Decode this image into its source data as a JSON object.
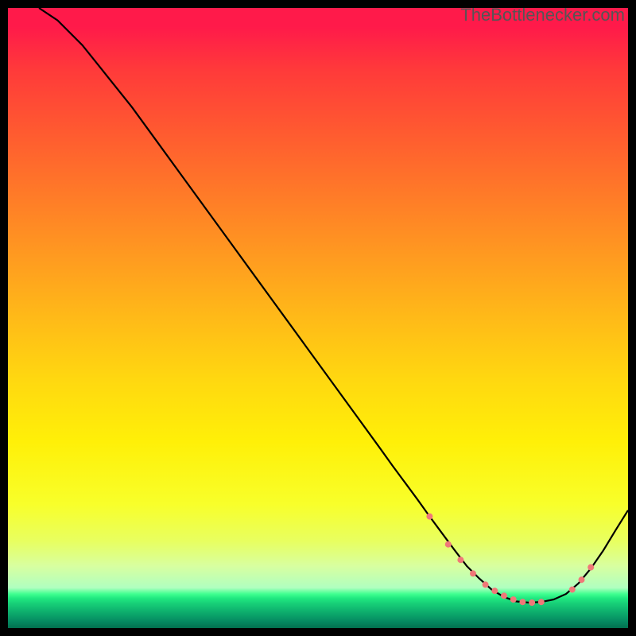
{
  "watermark": "TheBottlenecker.com",
  "chart_data": {
    "type": "line",
    "title": "",
    "xlabel": "",
    "ylabel": "",
    "xlim": [
      0,
      100
    ],
    "ylim": [
      0,
      100
    ],
    "grid": false,
    "legend": false,
    "background_gradient": {
      "direction": "vertical",
      "stops": [
        {
          "pos": 0,
          "color": "#ff1a4a",
          "meaning": "worst"
        },
        {
          "pos": 50,
          "color": "#ffd000",
          "meaning": "mid"
        },
        {
          "pos": 95,
          "color": "#20e880",
          "meaning": "best"
        }
      ]
    },
    "series": [
      {
        "name": "bottleneck-curve",
        "color": "#000000",
        "x": [
          5,
          8,
          12,
          16,
          20,
          24,
          28,
          32,
          36,
          40,
          44,
          48,
          52,
          56,
          60,
          62,
          64,
          66,
          68,
          70,
          72,
          74,
          76,
          78,
          80,
          82,
          84,
          86,
          88,
          90,
          92,
          94,
          96,
          98,
          100
        ],
        "y": [
          100,
          98,
          94,
          89,
          84,
          78.5,
          73,
          67.5,
          62,
          56.5,
          51,
          45.5,
          40,
          34.5,
          29,
          26.2,
          23.5,
          20.8,
          18,
          15.3,
          12.6,
          10,
          8,
          6.2,
          5,
          4.3,
          4.1,
          4.2,
          4.6,
          5.5,
          7.2,
          9.6,
          12.5,
          15.8,
          19
        ]
      }
    ],
    "markers": [
      {
        "name": "optimal-points",
        "color": "#f07878",
        "shape": "circle",
        "size": 8,
        "points": [
          {
            "x": 68,
            "y": 18
          },
          {
            "x": 71,
            "y": 13.5
          },
          {
            "x": 73,
            "y": 11
          },
          {
            "x": 75,
            "y": 8.8
          },
          {
            "x": 77,
            "y": 7
          },
          {
            "x": 78.5,
            "y": 6
          },
          {
            "x": 80,
            "y": 5.2
          },
          {
            "x": 81.5,
            "y": 4.6
          },
          {
            "x": 83,
            "y": 4.2
          },
          {
            "x": 84.5,
            "y": 4.1
          },
          {
            "x": 86,
            "y": 4.2
          },
          {
            "x": 91,
            "y": 6.2
          },
          {
            "x": 92.5,
            "y": 7.8
          },
          {
            "x": 94,
            "y": 9.8
          }
        ]
      }
    ]
  }
}
